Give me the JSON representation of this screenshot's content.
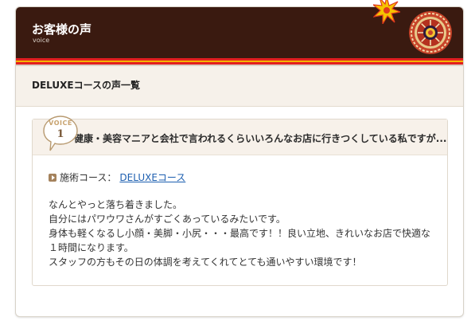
{
  "header": {
    "title": "お客様の声",
    "subtitle": "voice"
  },
  "list_heading": "DELUXEコースの声一覧",
  "voice": {
    "badge_label": "VOICE",
    "badge_number": "1",
    "title": "健康・美容マニアと会社で言われるくらいいろんなお店に行きつくしている私ですが...",
    "course_label": "施術コース：",
    "course_link": "DELUXEコース",
    "body_lines": [
      "なんとやっと落ち着きました。",
      "自分にはパワウワさんがすごくあっているみたいです。",
      "身体も軽くなるし小顔・美脚・小尻・・・最高です！！良い立地、きれいなお店で快適な",
      "１時間になります。",
      "スタッフの方もその日の体調を考えてくれてとても通いやすい環境です！"
    ]
  },
  "colors": {
    "header_bg": "#3a1a10",
    "stripe_red": "#e21f1f",
    "stripe_yellow": "#f4b400",
    "link": "#1d5fb0",
    "badge_accent": "#c8a36f"
  },
  "icons": [
    "sunburst-star-icon",
    "decorative-medallion-icon",
    "play-bullet-icon",
    "speech-bubble-icon"
  ]
}
